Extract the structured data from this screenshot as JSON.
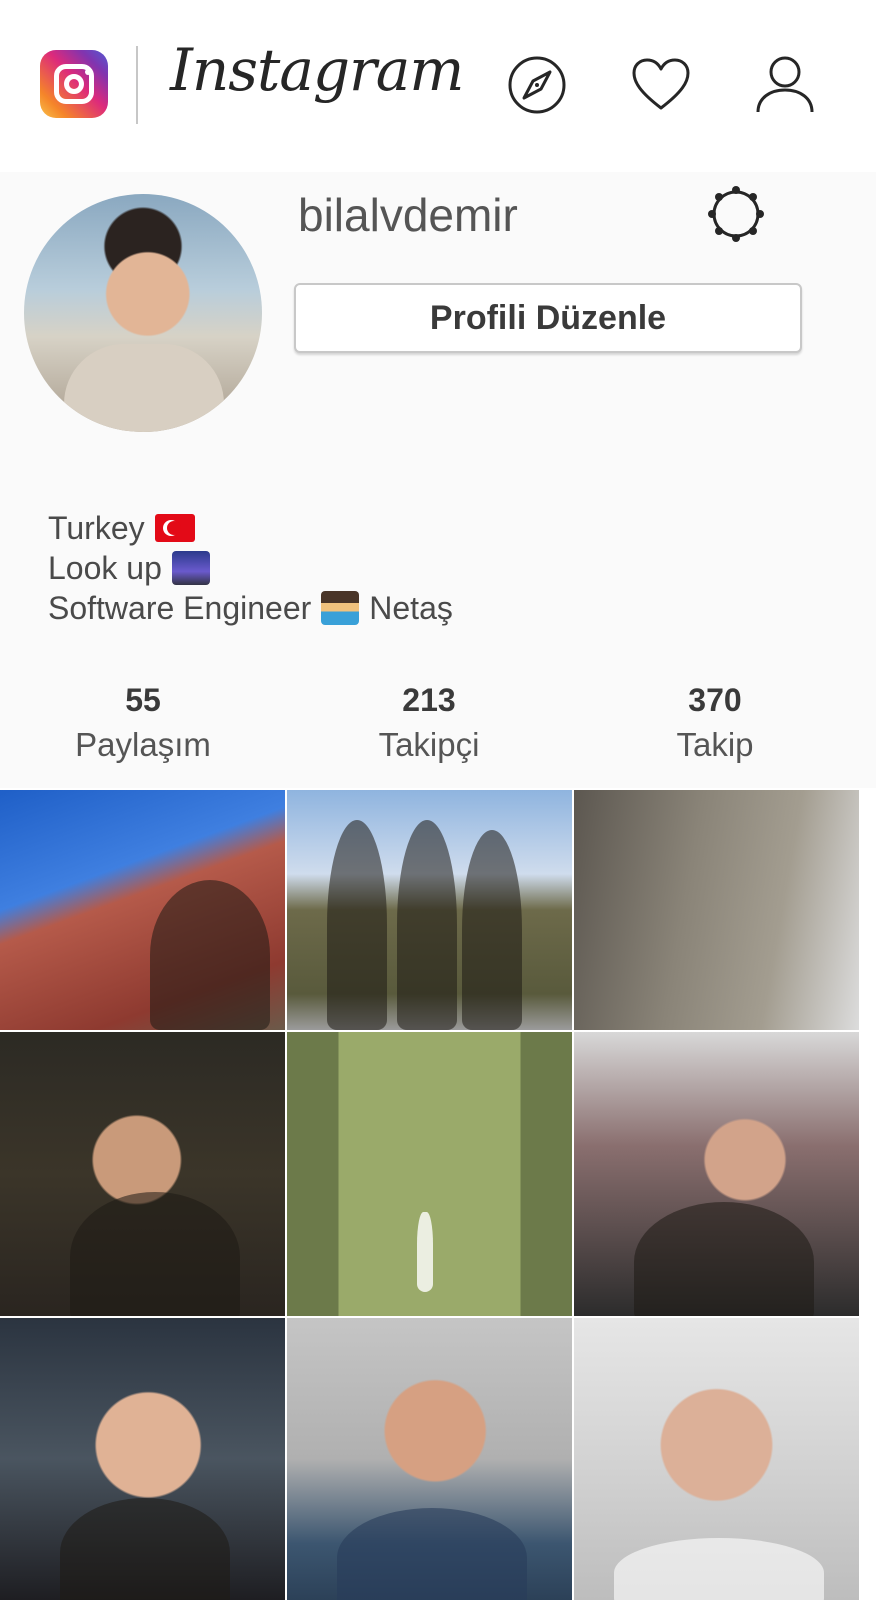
{
  "header": {
    "app_name": "Instagram",
    "icons": [
      "instagram-logo",
      "compass-icon",
      "heart-icon",
      "user-icon"
    ]
  },
  "profile": {
    "username": "bilalvdemir",
    "edit_button": "Profili Düzenle",
    "bio": {
      "line1": "Turkey",
      "line2": "Look up",
      "line3_prefix": "Software Engineer",
      "line3_suffix": "Netaş"
    }
  },
  "stats": {
    "posts": {
      "value": "55",
      "label": "Paylaşım"
    },
    "followers": {
      "value": "213",
      "label": "Takipçi"
    },
    "following": {
      "value": "370",
      "label": "Takip"
    }
  },
  "colors": {
    "background": "#fafafa",
    "header": "#ffffff",
    "text": "#262626"
  },
  "grid": {
    "count": 9
  }
}
